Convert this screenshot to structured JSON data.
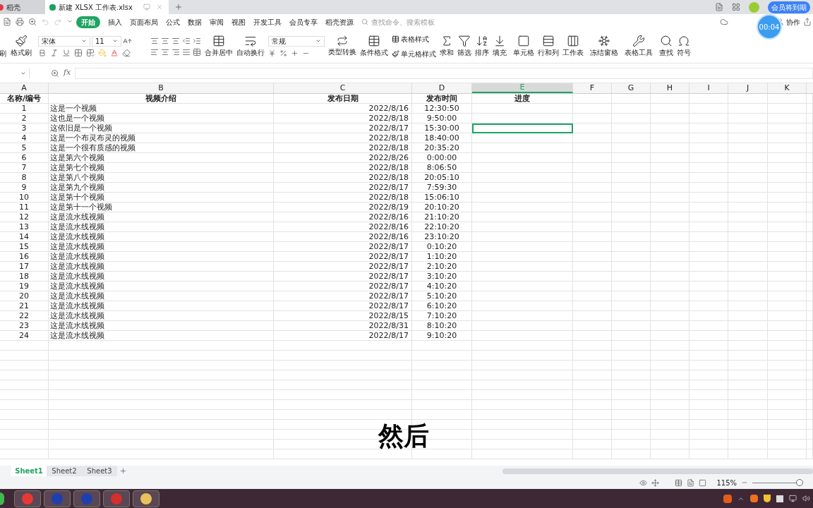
{
  "window_tabs": [
    {
      "label": "稻壳",
      "selected": false
    },
    {
      "label": "新建 XLSX 工作表.xlsx",
      "selected": true
    }
  ],
  "member_badge": "会员将到期",
  "menu": [
    {
      "label": "开始",
      "selected": true
    },
    {
      "label": "插入",
      "selected": false
    },
    {
      "label": "页面布局",
      "selected": false
    },
    {
      "label": "公式",
      "selected": false
    },
    {
      "label": "数据",
      "selected": false
    },
    {
      "label": "审阅",
      "selected": false
    },
    {
      "label": "视图",
      "selected": false
    },
    {
      "label": "开发工具",
      "selected": false
    },
    {
      "label": "会员专享",
      "selected": false
    },
    {
      "label": "稻壳资源",
      "selected": false
    }
  ],
  "search": {
    "placeholder": "查找命令、搜索模板"
  },
  "collab": "协作",
  "ribbon": {
    "cut_label": "刷",
    "format_painter": "格式刷",
    "font": "宋体",
    "font_size": "11",
    "merge": "合并居中",
    "wrap": "自动换行",
    "number_format": "常规",
    "convert": "类型转换",
    "conditional": "条件格式",
    "table_style": "表格样式",
    "cell_style": "单元格样式",
    "tools": [
      {
        "label": "求和"
      },
      {
        "label": "筛选"
      },
      {
        "label": "排序"
      },
      {
        "label": "填充"
      },
      {
        "label": "单元格"
      },
      {
        "label": "行和列"
      },
      {
        "label": "工作表"
      },
      {
        "label": "冻结窗格"
      },
      {
        "label": "表格工具"
      },
      {
        "label": "查找"
      },
      {
        "label": "符号"
      }
    ]
  },
  "formula_bar": {
    "fx": "fx"
  },
  "columns": [
    {
      "label": "A",
      "selected": false
    },
    {
      "label": "B",
      "selected": false
    },
    {
      "label": "C",
      "selected": false
    },
    {
      "label": "D",
      "selected": false
    },
    {
      "label": "E",
      "selected": true
    },
    {
      "label": "F",
      "selected": false
    },
    {
      "label": "G",
      "selected": false
    },
    {
      "label": "H",
      "selected": false
    },
    {
      "label": "I",
      "selected": false
    },
    {
      "label": "J",
      "selected": false
    },
    {
      "label": "K",
      "selected": false
    }
  ],
  "header_row": [
    "名称/编号",
    "视频介绍",
    "发布日期",
    "发布时间",
    "进度"
  ],
  "rows": [
    {
      "no": "1",
      "intro": "这是一个视频",
      "date": "2022/8/16",
      "time": "12:30:50",
      "selected": false
    },
    {
      "no": "2",
      "intro": "这也是一个视频",
      "date": "2022/8/18",
      "time": "9:50:00",
      "selected": false
    },
    {
      "no": "3",
      "intro": "这依旧是一个视频",
      "date": "2022/8/17",
      "time": "15:30:00",
      "selected": true
    },
    {
      "no": "4",
      "intro": "这是一个布灵布灵的视频",
      "date": "2022/8/18",
      "time": "18:40:00",
      "selected": false
    },
    {
      "no": "5",
      "intro": "这是一个很有质感的视频",
      "date": "2022/8/18",
      "time": "20:35:20",
      "selected": false
    },
    {
      "no": "6",
      "intro": "这是第六个视频",
      "date": "2022/8/26",
      "time": "0:00:00",
      "selected": false
    },
    {
      "no": "7",
      "intro": "这是第七个视频",
      "date": "2022/8/18",
      "time": "8:06:50",
      "selected": false
    },
    {
      "no": "8",
      "intro": "这是第八个视频",
      "date": "2022/8/18",
      "time": "20:05:10",
      "selected": false
    },
    {
      "no": "9",
      "intro": "这是第九个视频",
      "date": "2022/8/17",
      "time": "7:59:30",
      "selected": false
    },
    {
      "no": "10",
      "intro": "这是第十个视频",
      "date": "2022/8/18",
      "time": "15:06:10",
      "selected": false
    },
    {
      "no": "11",
      "intro": "这是第十一个视频",
      "date": "2022/8/19",
      "time": "20:10:20",
      "selected": false
    },
    {
      "no": "12",
      "intro": "这是流水线视频",
      "date": "2022/8/16",
      "time": "21:10:20",
      "selected": false
    },
    {
      "no": "13",
      "intro": "这是流水线视频",
      "date": "2022/8/16",
      "time": "22:10:20",
      "selected": false
    },
    {
      "no": "14",
      "intro": "这是流水线视频",
      "date": "2022/8/16",
      "time": "23:10:20",
      "selected": false
    },
    {
      "no": "15",
      "intro": "这是流水线视频",
      "date": "2022/8/17",
      "time": "0:10:20",
      "selected": false
    },
    {
      "no": "16",
      "intro": "这是流水线视频",
      "date": "2022/8/17",
      "time": "1:10:20",
      "selected": false
    },
    {
      "no": "17",
      "intro": "这是流水线视频",
      "date": "2022/8/17",
      "time": "2:10:20",
      "selected": false
    },
    {
      "no": "18",
      "intro": "这是流水线视频",
      "date": "2022/8/17",
      "time": "3:10:20",
      "selected": false
    },
    {
      "no": "19",
      "intro": "这是流水线视频",
      "date": "2022/8/17",
      "time": "4:10:20",
      "selected": false
    },
    {
      "no": "20",
      "intro": "这是流水线视频",
      "date": "2022/8/17",
      "time": "5:10:20",
      "selected": false
    },
    {
      "no": "21",
      "intro": "这是流水线视频",
      "date": "2022/8/17",
      "time": "6:10:20",
      "selected": false
    },
    {
      "no": "22",
      "intro": "这是流水线视频",
      "date": "2022/8/15",
      "time": "7:10:20",
      "selected": false
    },
    {
      "no": "23",
      "intro": "这是流水线视频",
      "date": "2022/8/31",
      "time": "8:10:20",
      "selected": false
    },
    {
      "no": "24",
      "intro": "这是流水线视频",
      "date": "2022/8/17",
      "time": "9:10:20",
      "selected": false
    }
  ],
  "sheet_tabs": [
    {
      "label": "Sheet1",
      "selected": true
    },
    {
      "label": "Sheet2",
      "selected": false
    },
    {
      "label": "Sheet3",
      "selected": false
    }
  ],
  "status_bar": {
    "zoom": "115%",
    "zoom_slider": {
      "level": 0.95
    }
  },
  "timer": "00:04",
  "subtitle": "然后"
}
